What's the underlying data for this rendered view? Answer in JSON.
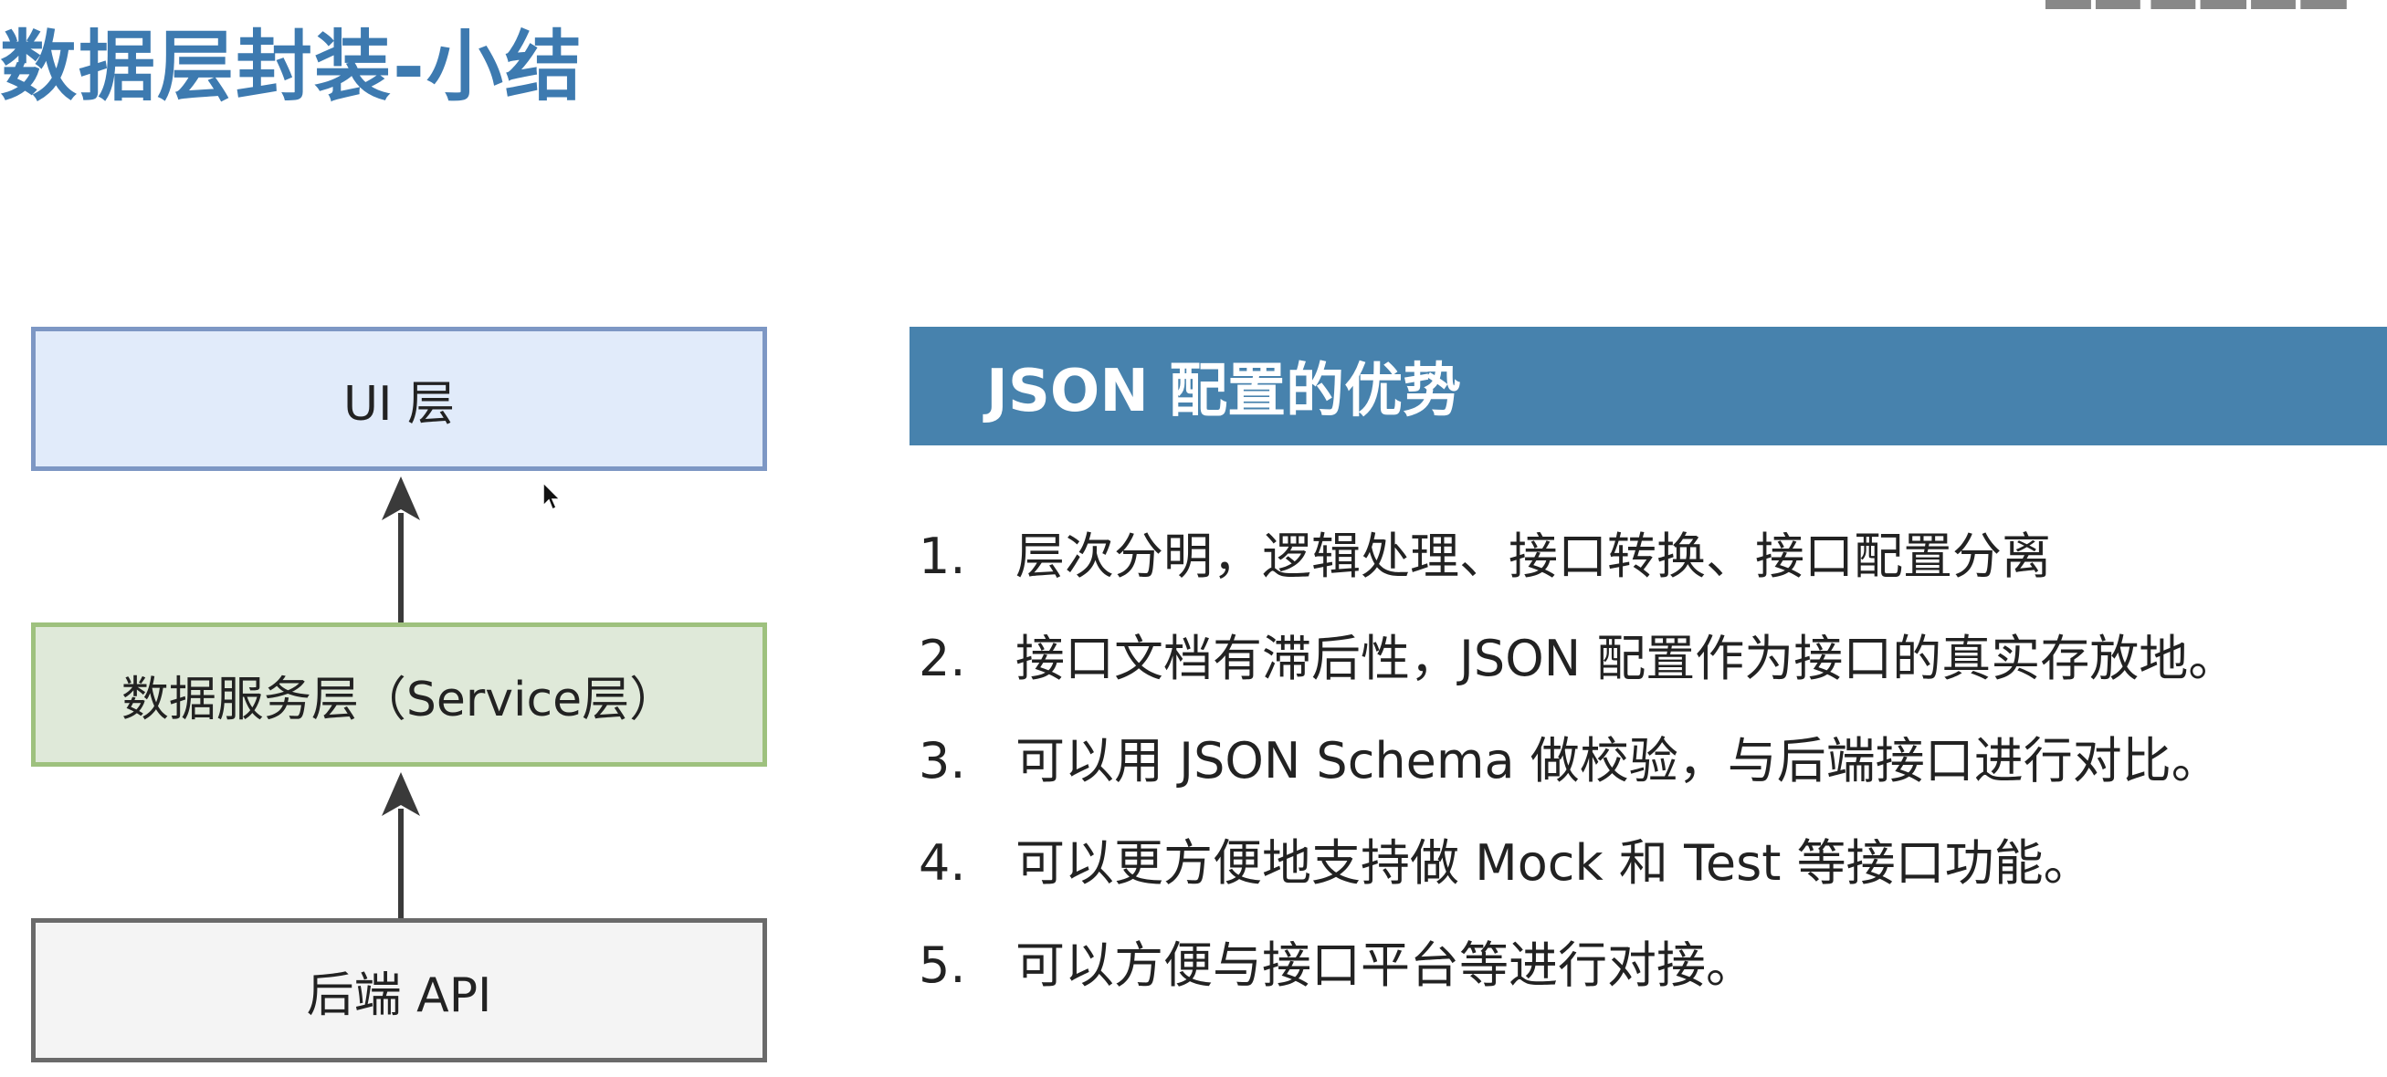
{
  "slide": {
    "title": "数据层封装-小结",
    "corner_fragment": "..."
  },
  "diagram": {
    "layers": {
      "ui": "UI 层",
      "service": "数据服务层（Service层）",
      "api": "后端 API"
    },
    "colors": {
      "ui_fill": "#e1ebfa",
      "ui_border": "#7d97c4",
      "service_fill": "#dfe9d9",
      "service_border": "#9ec17e",
      "api_fill": "#f4f4f4",
      "api_border": "#6a6a6a",
      "arrow": "#3a3a3a"
    }
  },
  "advantages": {
    "header": "JSON 配置的优势",
    "header_color": "#4782ad",
    "items": [
      {
        "num": "1.",
        "text": "层次分明，逻辑处理、接口转换、接口配置分离"
      },
      {
        "num": "2.",
        "text": "接口文档有滞后性，JSON 配置作为接口的真实存放地。"
      },
      {
        "num": "3.",
        "text": "可以用 JSON Schema 做校验，与后端接口进行对比。"
      },
      {
        "num": "4.",
        "text": "可以更方便地支持做 Mock 和 Test 等接口功能。"
      },
      {
        "num": "5.",
        "text": "可以方便与接口平台等进行对接。"
      }
    ]
  }
}
